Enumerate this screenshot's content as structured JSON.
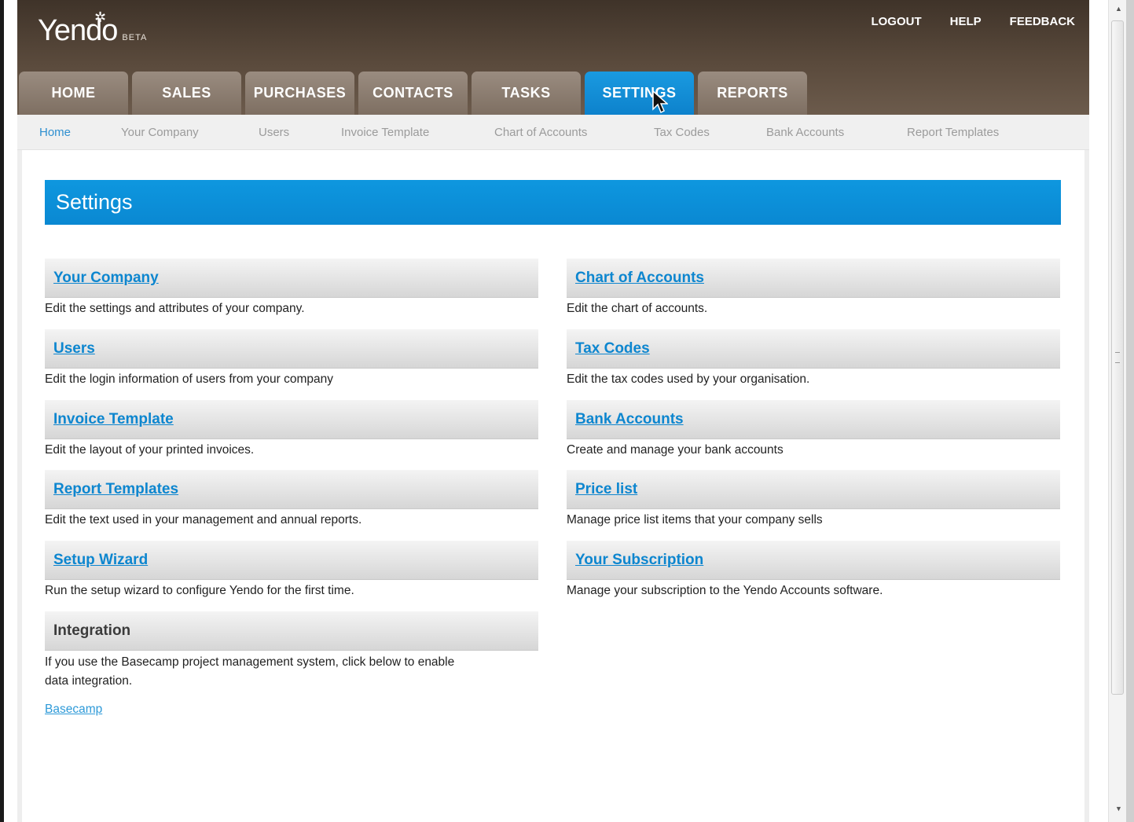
{
  "app": {
    "logo_text": "Yendo",
    "beta_label": "BETA"
  },
  "top_links": {
    "logout": "LOGOUT",
    "help": "HELP",
    "feedback": "FEEDBACK"
  },
  "tabs": [
    {
      "label": "HOME"
    },
    {
      "label": "SALES"
    },
    {
      "label": "PURCHASES"
    },
    {
      "label": "CONTACTS"
    },
    {
      "label": "TASKS"
    },
    {
      "label": "SETTINGS",
      "active": true
    },
    {
      "label": "REPORTS"
    }
  ],
  "subnav": [
    {
      "label": "Home",
      "active": true
    },
    {
      "label": "Your Company"
    },
    {
      "label": "Users"
    },
    {
      "label": "Invoice Template"
    },
    {
      "label": "Chart of Accounts"
    },
    {
      "label": "Tax Codes"
    },
    {
      "label": "Bank Accounts"
    },
    {
      "label": "Report Templates"
    }
  ],
  "page_title": "Settings",
  "left_sections": [
    {
      "title": "Your Company",
      "desc": "Edit the settings and attributes of your company."
    },
    {
      "title": "Users",
      "desc": "Edit the login information of users from your company"
    },
    {
      "title": "Invoice Template",
      "desc": "Edit the layout of your printed invoices."
    },
    {
      "title": "Report Templates",
      "desc": "Edit the text used in your management and annual reports."
    },
    {
      "title": "Setup Wizard",
      "desc": "Run the setup wizard to configure Yendo for the first time."
    }
  ],
  "right_sections": [
    {
      "title": "Chart of Accounts",
      "desc": "Edit the chart of accounts."
    },
    {
      "title": "Tax Codes",
      "desc": "Edit the tax codes used by your organisation."
    },
    {
      "title": "Bank Accounts",
      "desc": "Create and manage your bank accounts"
    },
    {
      "title": "Price list",
      "desc": "Manage price list items that your company sells"
    },
    {
      "title": "Your Subscription",
      "desc": "Manage your subscription to the Yendo Accounts software."
    }
  ],
  "integration": {
    "title": "Integration",
    "desc_line1": "If you use the Basecamp project management system, click below to enable",
    "desc_line2": "data integration.",
    "link": "Basecamp"
  },
  "colors": {
    "header_brown": "#4e4034",
    "accent_blue": "#0d86cf",
    "tab_inactive": "#8a7b6e"
  }
}
